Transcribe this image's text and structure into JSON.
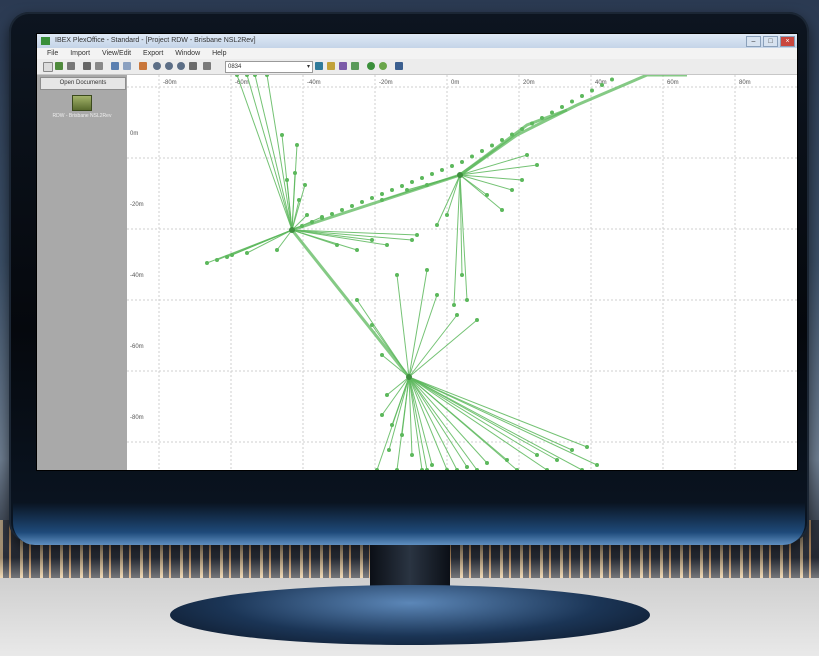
{
  "window": {
    "title": "IBEX PlexOffice - Standard - [Project RDW - Brisbane NSL2Rev]",
    "controls": [
      "–",
      "□",
      "×"
    ]
  },
  "menu": [
    "File",
    "Import",
    "View/Edit",
    "Export",
    "Window",
    "Help"
  ],
  "toolbar": {
    "selected_layer": "0834"
  },
  "left_panel": {
    "header": "Open Documents",
    "document_label": "RDW - Brisbane NSL2Rev"
  },
  "plot": {
    "x_ticks": [
      "-80m",
      "-60m",
      "-40m",
      "-20m",
      "0m",
      "20m",
      "40m",
      "60m",
      "80m"
    ],
    "y_ticks": [
      "0m",
      "-20m",
      "-40m",
      "-60m",
      "-80m"
    ],
    "line_color": "#5cb85c",
    "grid": true
  }
}
